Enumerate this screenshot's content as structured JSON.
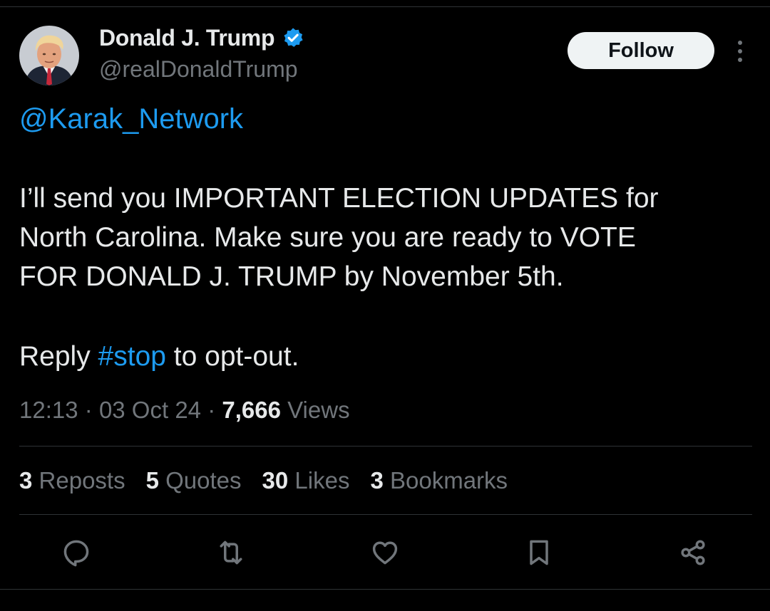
{
  "author": {
    "display_name": "Donald J. Trump",
    "handle": "@realDonaldTrump",
    "verified_icon": "verified-badge-icon",
    "verified_color": "#1d9bf0"
  },
  "follow_label": "Follow",
  "tweet": {
    "mention": "@Karak_Network",
    "body_lines": [
      "I’ll send you IMPORTANT ELECTION UPDATES for",
      "North Carolina. Make sure you are ready to VOTE",
      "FOR DONALD J. TRUMP by November 5th."
    ],
    "reply_prefix": "Reply ",
    "hashtag": "#stop",
    "reply_suffix": " to opt-out."
  },
  "meta": {
    "time": "12:13",
    "separator": "·",
    "date": "03 Oct 24",
    "views_count": "7,666",
    "views_label": "Views"
  },
  "stats": [
    {
      "count": "3",
      "label": "Reposts"
    },
    {
      "count": "5",
      "label": "Quotes"
    },
    {
      "count": "30",
      "label": "Likes"
    },
    {
      "count": "3",
      "label": "Bookmarks"
    }
  ],
  "actions": [
    "reply-icon",
    "repost-icon",
    "like-icon",
    "bookmark-icon",
    "share-icon"
  ],
  "colors": {
    "background": "#000000",
    "text": "#e7e9ea",
    "secondary": "#71767b",
    "accent": "#1d9bf0",
    "divider": "#2f3336"
  }
}
